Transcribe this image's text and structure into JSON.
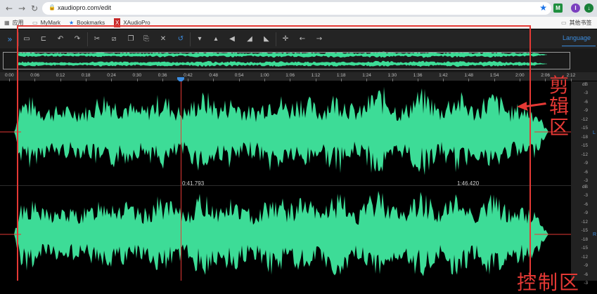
{
  "browser": {
    "url": "xaudiopro.com/edit",
    "bookmarks": [
      {
        "label": "应用"
      },
      {
        "label": "MyMark"
      },
      {
        "label": "Bookmarks"
      },
      {
        "label": "XAudioPro"
      }
    ],
    "other_bookmarks": "其他书签",
    "ext_badge": "I"
  },
  "toolbar": {
    "language": "Language",
    "buttons": [
      "sidebar-toggle",
      "open",
      "trim",
      "undo",
      "redo",
      "cut",
      "crop",
      "copy",
      "paste",
      "delete",
      "reset",
      "volume-down",
      "volume-up",
      "mute",
      "fade-in",
      "fade-out",
      "add-marker",
      "move-left",
      "move-right"
    ]
  },
  "timeline": {
    "ticks": [
      "0:00",
      "0:06",
      "0:12",
      "0:18",
      "0:24",
      "0:30",
      "0:36",
      "0:42",
      "0:48",
      "0:54",
      "1:00",
      "1:06",
      "1:12",
      "1:18",
      "1:24",
      "1:30",
      "1:36",
      "1:42",
      "1:48",
      "1:54",
      "2:00",
      "2:06",
      "2:12"
    ]
  },
  "time_markers": {
    "cursor": "0:41.793",
    "end": "1:46.420"
  },
  "db_scale": {
    "unit": "dB",
    "labels": [
      "-3",
      "-6",
      "-9",
      "-12",
      "-15",
      "-18",
      "-15",
      "-12",
      "-9",
      "-6",
      "-3"
    ],
    "channels": [
      "L",
      "R"
    ]
  },
  "annotations": {
    "edit_area": "剪辑区",
    "bottom_partial": "控制区"
  },
  "colors": {
    "waveform": "#3ddc97",
    "accent": "#3b8de0",
    "annotation": "#e53935"
  }
}
